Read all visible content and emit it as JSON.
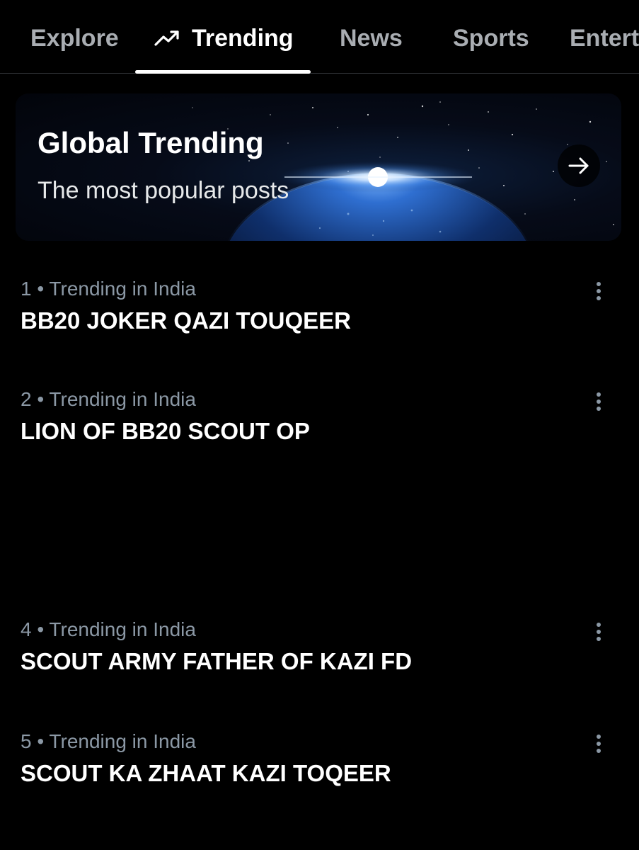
{
  "tabs": [
    {
      "label": "Explore",
      "active": false
    },
    {
      "label": "Trending",
      "active": true,
      "icon": "trending-up-icon"
    },
    {
      "label": "News",
      "active": false
    },
    {
      "label": "Sports",
      "active": false
    },
    {
      "label": "Entert",
      "active": false
    }
  ],
  "banner": {
    "title": "Global Trending",
    "subtitle": "The most popular posts",
    "arrow_icon": "arrow-right-icon"
  },
  "trends": [
    {
      "meta": "1 • Trending in India",
      "title": "BB20 JOKER QAZI TOUQEER"
    },
    {
      "meta": "2 • Trending in India",
      "title": "LION OF BB20 SCOUT OP"
    },
    {
      "meta": "4 • Trending in India",
      "title": "SCOUT ARMY FATHER OF KAZI FD"
    },
    {
      "meta": "5 • Trending in India",
      "title": "SCOUT KA ZHAAT KAZI TOQEER"
    }
  ],
  "colors": {
    "background": "#000000",
    "active_tab": "#ffffff",
    "inactive_tab": "#a9adb2",
    "meta_text": "#8b98a5",
    "divider": "#2f3336"
  }
}
